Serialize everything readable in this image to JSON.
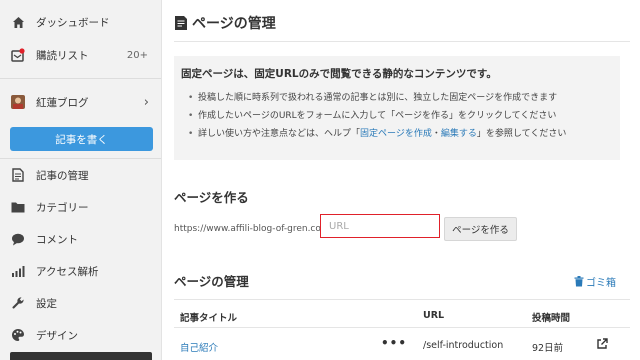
{
  "sidebar": {
    "items": [
      {
        "label": "ダッシュボード",
        "icon": "home-icon"
      },
      {
        "label": "購読リスト",
        "icon": "subscription-icon",
        "count": "20+"
      },
      {
        "label": "紅蓮ブログ",
        "icon": "blog-avatar",
        "chevron": "›"
      },
      {
        "label": "記事の管理",
        "icon": "document-icon"
      },
      {
        "label": "カテゴリー",
        "icon": "folder-icon"
      },
      {
        "label": "コメント",
        "icon": "comment-icon"
      },
      {
        "label": "アクセス解析",
        "icon": "analytics-icon"
      },
      {
        "label": "設定",
        "icon": "wrench-icon"
      },
      {
        "label": "デザイン",
        "icon": "palette-icon"
      }
    ],
    "write_button": "記事を書く"
  },
  "main": {
    "title": "ページの管理",
    "info": {
      "heading": "固定ページは、固定URLのみで閲覧できる静的なコンテンツです。",
      "line1": "投稿した順に時系列で扱われる通常の記事とは別に、独立した固定ページを作成できます",
      "line2": "作成したいページのURLをフォームに入力して「ページを作る」をクリックしてください",
      "line3_pre": "詳しい使い方や注意点などは、ヘルプ「",
      "line3_link1": "固定ページを作成",
      "line3_sep": "・",
      "line3_link2": "編集する",
      "line3_post": "」を参照してください"
    },
    "create": {
      "title": "ページを作る",
      "url_prefix": "https://www.affili-blog-of-gren.com/",
      "input_placeholder": "URL",
      "button": "ページを作る"
    },
    "manage": {
      "title": "ページの管理",
      "trash": "ゴミ箱",
      "columns": [
        "記事タイトル",
        "URL",
        "投稿時間"
      ],
      "rows": [
        {
          "title": "自己紹介",
          "menu": "•••",
          "url": "/self-introduction",
          "time": "92日前"
        }
      ]
    }
  },
  "colors": {
    "accent": "#3c98de",
    "link": "#2a7ab8",
    "highlight": "#e0212a"
  }
}
